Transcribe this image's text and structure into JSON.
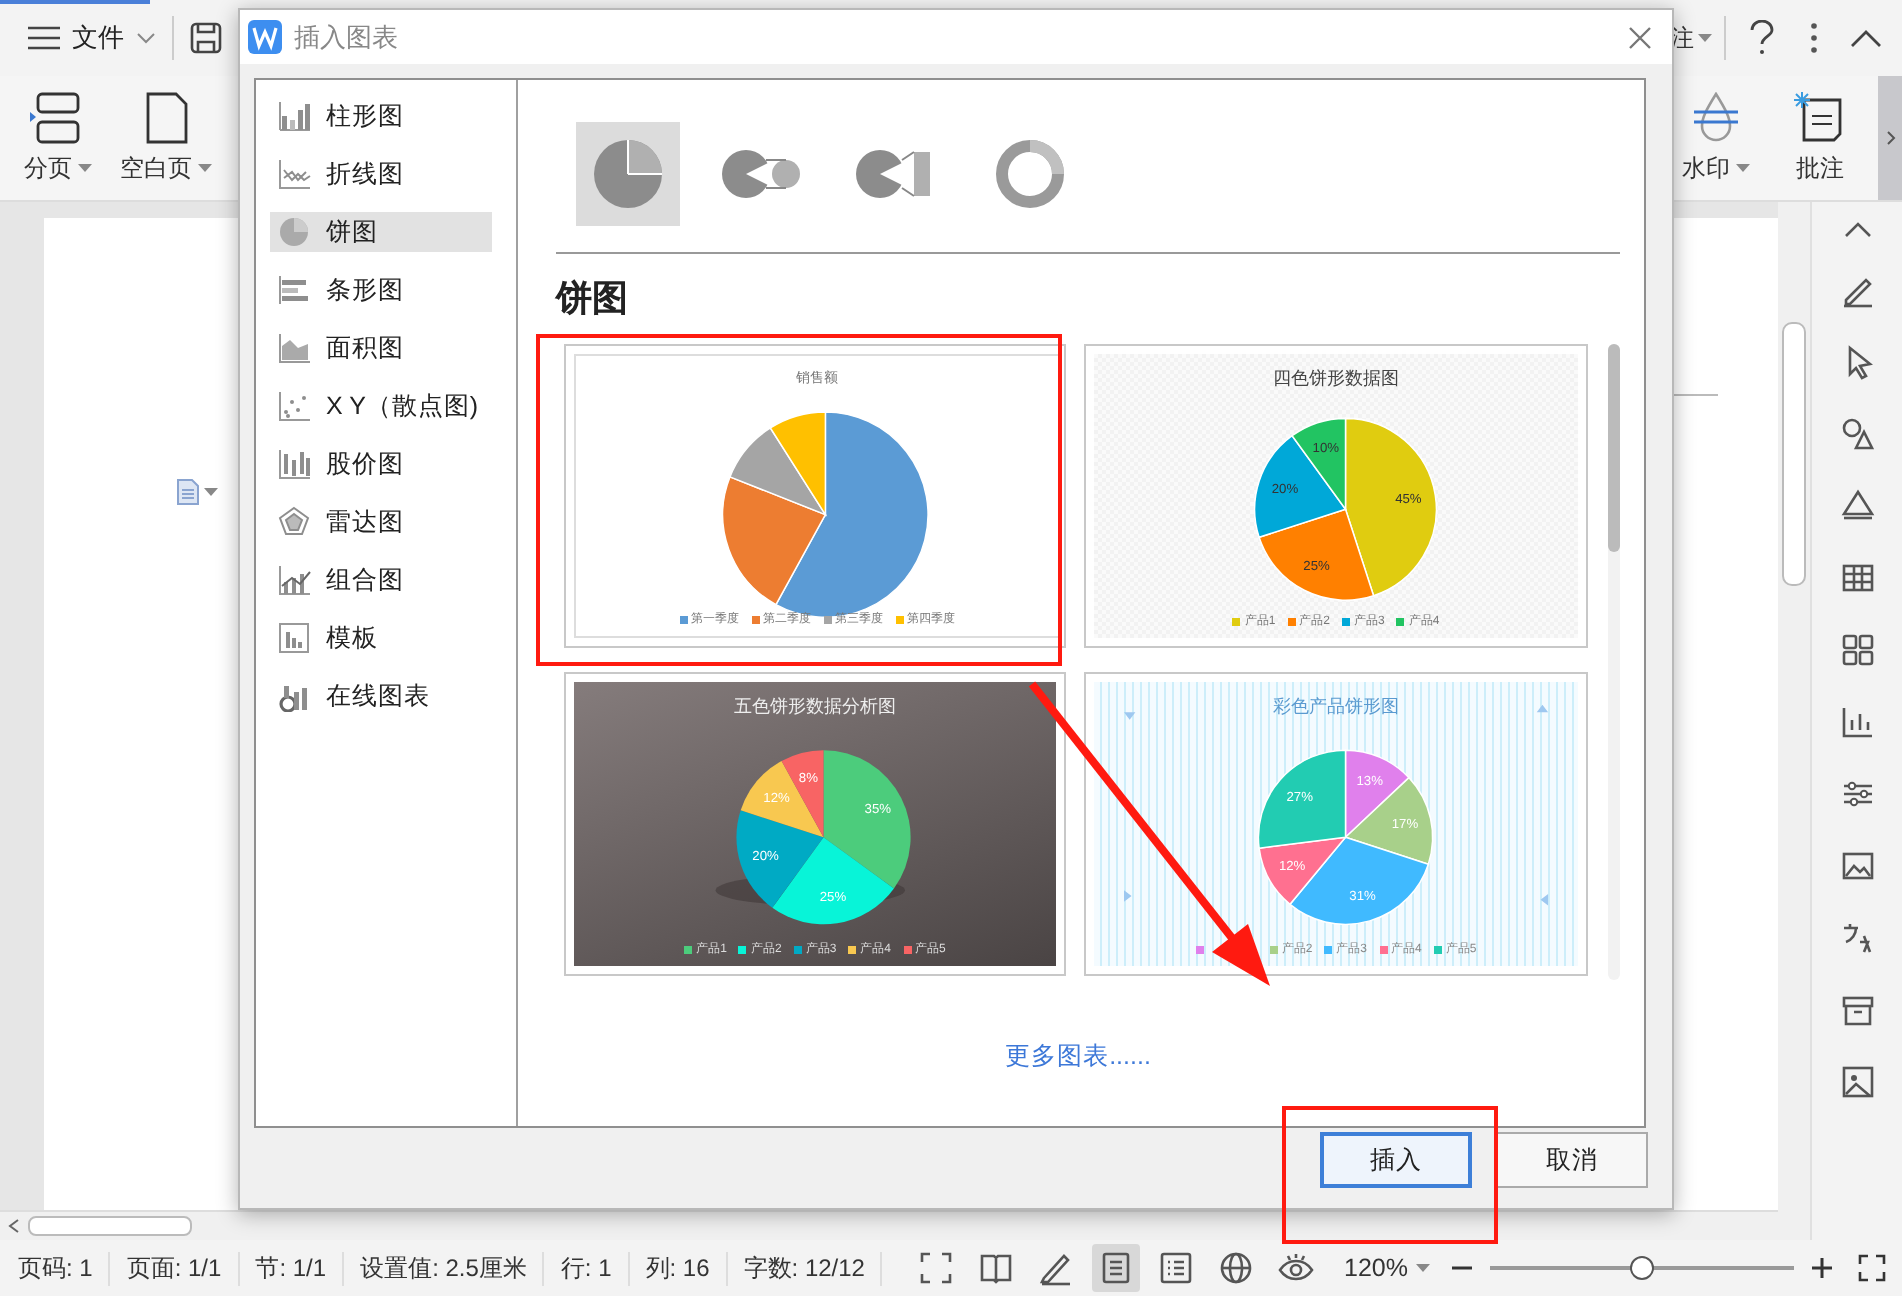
{
  "app": {
    "menu": {
      "label": "文件"
    },
    "ribbon_left": [
      {
        "label": "分页"
      },
      {
        "label": "空白页"
      }
    ],
    "ribbon_partial": {
      "label": "注"
    },
    "ribbon_right": [
      {
        "label": "水印",
        "caret": true
      },
      {
        "label": "批注",
        "caret": false
      }
    ],
    "status_bar": {
      "items": [
        "页码: 1",
        "页面: 1/1",
        "节: 1/1",
        "设置值: 2.5厘米",
        "行: 1",
        "列: 16",
        "字数: 12/12"
      ],
      "view_buttons": [
        {
          "kind": "fullscreen",
          "selected": false
        },
        {
          "kind": "book",
          "selected": false
        },
        {
          "kind": "pen",
          "selected": false
        },
        {
          "kind": "page",
          "selected": true
        },
        {
          "kind": "outline",
          "selected": false
        },
        {
          "kind": "web",
          "selected": false
        },
        {
          "kind": "eye",
          "selected": false
        }
      ],
      "zoom": "120%",
      "zoom_slider": {
        "level": 0.5
      }
    }
  },
  "dialog": {
    "title": "插入图表",
    "sidebar": {
      "items": [
        {
          "label": "柱形图",
          "selected": false
        },
        {
          "label": "折线图",
          "selected": false
        },
        {
          "label": "饼图",
          "selected": true
        },
        {
          "label": "条形图",
          "selected": false
        },
        {
          "label": "面积图",
          "selected": false
        },
        {
          "label": "X Y（散点图)",
          "selected": false
        },
        {
          "label": "股价图",
          "selected": false
        },
        {
          "label": "雷达图",
          "selected": false
        },
        {
          "label": "组合图",
          "selected": false
        },
        {
          "label": "模板",
          "selected": false
        },
        {
          "label": "在线图表",
          "selected": false
        }
      ]
    },
    "subtypes": [
      {
        "kind": "pie",
        "selected": true
      },
      {
        "kind": "pie-of-pie",
        "selected": false
      },
      {
        "kind": "bar-of-pie",
        "selected": false
      },
      {
        "kind": "donut",
        "selected": false
      }
    ],
    "section_title": "饼图",
    "templates": [
      {
        "kind": "plain",
        "title": "销售额",
        "legend": [
          "第一季度",
          "第二季度",
          "第三季度",
          "第四季度"
        ]
      },
      {
        "kind": "chart",
        "chart_data": {
          "type": "pie",
          "title": "四色饼形数据图",
          "legend": "bottom",
          "categories": [
            "产品1",
            "产品2",
            "产品3",
            "产品4"
          ],
          "series": [
            {
              "values": [
                45,
                25,
                20,
                10
              ]
            }
          ],
          "colors": [
            "#e0cc10",
            "#ff8000",
            "#00a8d8",
            "#22c462"
          ],
          "value_labels": [
            "45%",
            "25%",
            "20%",
            "10%"
          ]
        }
      },
      {
        "kind": "chart",
        "chart_data": {
          "type": "pie",
          "title": "五色饼形数据分析图",
          "legend": "bottom",
          "categories": [
            "产品1",
            "产品2",
            "产品3",
            "产品4",
            "产品5"
          ],
          "series": [
            {
              "values": [
                35,
                25,
                20,
                12,
                8
              ]
            }
          ],
          "colors": [
            "#4ccc7c",
            "#08f4d8",
            "#00aac4",
            "#f8c850",
            "#f86464"
          ],
          "value_labels": [
            "35%",
            "25%",
            "20%",
            "12%",
            "8%"
          ]
        }
      },
      {
        "kind": "chart",
        "chart_data": {
          "type": "pie",
          "title": "彩色产品饼形图",
          "legend": "bottom",
          "categories": [
            null,
            "产品2",
            "产品3",
            "产品4",
            "产品5"
          ],
          "series": [
            {
              "values": [
                13,
                17,
                31,
                12,
                27
              ]
            }
          ],
          "colors": [
            "#e080ec",
            "#a8d08a",
            "#40baff",
            "#ff7090",
            "#22ccb2"
          ],
          "value_labels": [
            "13%",
            "17%",
            "31%",
            "12%",
            "27%"
          ]
        }
      }
    ],
    "more_link": "更多图表......",
    "buttons": [
      {
        "label": "插入",
        "kind": "primary"
      },
      {
        "label": "取消",
        "kind": "secondary"
      }
    ]
  },
  "annotations": [
    {
      "kind": "frame"
    },
    {
      "kind": "frame"
    },
    {
      "kind": "arrow"
    }
  ]
}
